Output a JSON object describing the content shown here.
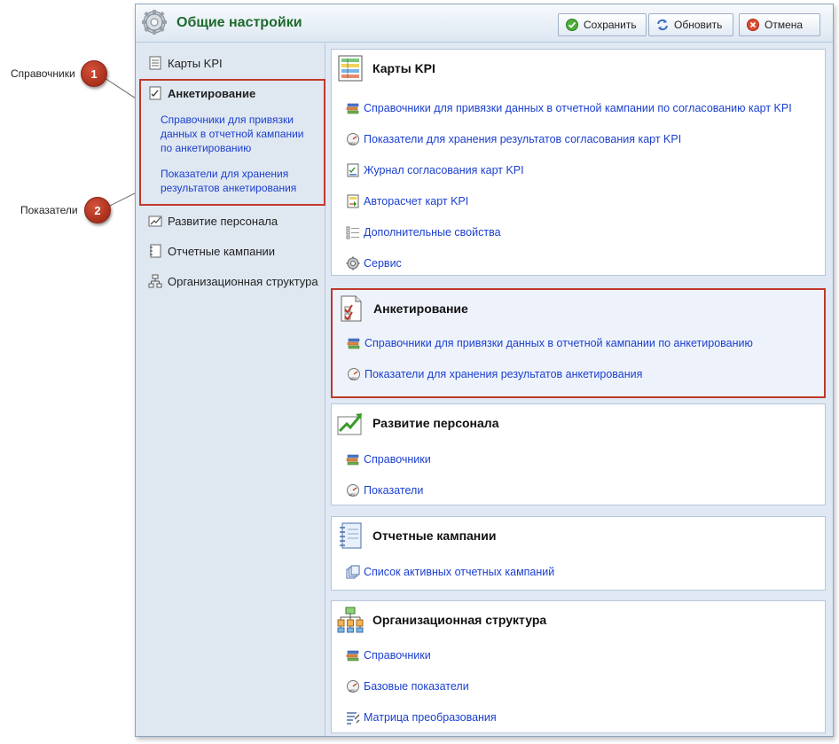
{
  "callouts": [
    {
      "number": "1",
      "label": "Справочники"
    },
    {
      "number": "2",
      "label": "Показатели"
    }
  ],
  "window": {
    "title": "Общие настройки",
    "buttons": {
      "save": "Сохранить",
      "refresh": "Обновить",
      "cancel": "Отмена"
    }
  },
  "sidebar": {
    "items": [
      {
        "label": "Карты KPI",
        "icon": "kpi-cards-icon"
      },
      {
        "label": "Анкетирование",
        "icon": "survey-icon",
        "active": true,
        "sub_links": [
          "Справочники для привязки данных в отчетной кампании по анкетированию",
          "Показатели для хранения результатов анкетирования"
        ]
      },
      {
        "label": "Развитие персонала",
        "icon": "growth-chart-icon"
      },
      {
        "label": "Отчетные кампании",
        "icon": "notebook-icon"
      },
      {
        "label": "Организационная структура",
        "icon": "org-structure-icon"
      }
    ]
  },
  "sections": [
    {
      "title": "Карты KPI",
      "icon": "kpi-cards-icon",
      "links": [
        {
          "label": "Справочники для привязки данных в отчетной кампании по согласованию карт KPI",
          "icon": "directory-icon"
        },
        {
          "label": "Показатели для хранения результатов согласования карт KPI",
          "icon": "indicator-gauge-icon"
        },
        {
          "label": "Журнал согласования карт KPI",
          "icon": "journal-icon"
        },
        {
          "label": "Авторасчет карт KPI",
          "icon": "autocalc-icon"
        },
        {
          "label": "Дополнительные свойства",
          "icon": "properties-icon"
        },
        {
          "label": "Сервис",
          "icon": "gear-icon"
        }
      ]
    },
    {
      "title": "Анкетирование",
      "icon": "survey-icon",
      "highlighted": true,
      "links": [
        {
          "label": "Справочники для привязки данных в отчетной кампании по анкетированию",
          "icon": "directory-icon"
        },
        {
          "label": "Показатели для хранения результатов анкетирования",
          "icon": "indicator-gauge-icon"
        }
      ]
    },
    {
      "title": "Развитие персонала",
      "icon": "growth-chart-icon",
      "links": [
        {
          "label": "Справочники",
          "icon": "directory-icon"
        },
        {
          "label": "Показатели",
          "icon": "indicator-gauge-icon"
        }
      ]
    },
    {
      "title": "Отчетные кампании",
      "icon": "notebook-icon",
      "links": [
        {
          "label": "Список активных отчетных кампаний",
          "icon": "campaign-list-icon"
        }
      ]
    },
    {
      "title": "Организационная структура",
      "icon": "org-structure-icon",
      "links": [
        {
          "label": "Справочники",
          "icon": "directory-icon"
        },
        {
          "label": "Базовые показатели",
          "icon": "indicator-gauge-icon"
        },
        {
          "label": "Матрица преобразования",
          "icon": "matrix-icon"
        }
      ]
    }
  ],
  "colors": {
    "accent_red": "#c0392b",
    "link_blue": "#1a3fcf",
    "title_green": "#1d6a2c"
  }
}
